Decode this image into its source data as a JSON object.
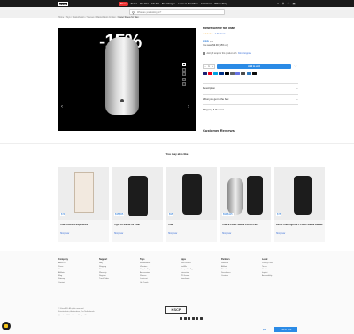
{
  "header": {
    "logo": "KSCP",
    "nav": [
      "Bleus",
      "Toutes",
      "Por Oise",
      "Fits Noi",
      "Bus Chaigne",
      "Ladies & Ammitibee",
      "Cad Orvas",
      "Where Shop"
    ],
    "icons": [
      "user-icon",
      "search-icon",
      "heart-icon",
      "cart-icon"
    ]
  },
  "search": {
    "placeholder": "What are you looking for?"
  },
  "breadcrumb": [
    "Home",
    "/",
    "Toys",
    "/",
    "Masturbators",
    "/",
    "Sleeves",
    "/",
    "Masturbators for Men",
    "/",
    "Power Sleeve for Titan"
  ],
  "gallery": {
    "badge": "-15%",
    "thumb_count": 5
  },
  "product": {
    "title": "Power Sleeve for Titan",
    "rating": "★★★★☆",
    "reviews": "1 Reviews",
    "price": "$55",
    "old_price": "$65",
    "saving": "You save $9.90 (15% off)",
    "optin": "Add gift wrap for this product with",
    "optin_link": "Kiiroo Engrave",
    "qty": "1",
    "add_to_cart": "Add to cart",
    "payments": [
      "#1a1f71",
      "#eb001b",
      "#00a1e0",
      "#003087",
      "#000000",
      "#5f6368",
      "#6772e5",
      "#4a4a4a",
      "#2e77bc",
      "#0a0a0a"
    ]
  },
  "accordions": [
    "Description",
    "What you get in the box",
    "Shipping & Returns"
  ],
  "reviews_heading": "Customer Reviews",
  "recommend_heading": "You may also like",
  "cards": [
    {
      "title": "Titan Premium Experience",
      "price": "$79",
      "cta": "Shop now"
    },
    {
      "title": "Tight Fit Sleeve for Titan",
      "price": "$35 $55",
      "cta": "Shop now"
    },
    {
      "title": "Titan",
      "price": "$95",
      "cta": "Shop now"
    },
    {
      "title": "Titan & Power Sleeve Combo Pack",
      "price": "$99 $115",
      "cta": "Shop now"
    },
    {
      "title": "Kiiroo Titan Tight Fit + Power Sleeve Bundle",
      "price": "$75",
      "cta": "Shop now"
    }
  ],
  "footer": {
    "columns": [
      {
        "head": "Company",
        "links": [
          "About Us",
          "Press",
          "Careers",
          "Affiliate",
          "Blog",
          "Sitemap",
          "Contact"
        ]
      },
      {
        "head": "Support",
        "links": [
          "FAQ",
          "Shipping",
          "Returns",
          "Warranty",
          "Register",
          "Track Order"
        ]
      },
      {
        "head": "Toys",
        "links": [
          "Masturbators",
          "Vibrators",
          "Couples Toys",
          "Accessories",
          "Sleeves",
          "Lubricant",
          "Gift Cards"
        ]
      },
      {
        "head": "Apps",
        "links": [
          "FeelConnect",
          "FeelMe",
          "Compatible Apps",
          "Interactive",
          "VR Games",
          "Downloads"
        ]
      },
      {
        "head": "Partners",
        "links": [
          "Webcam",
          "Affiliate",
          "Retailers",
          "Developers",
          "Creators"
        ]
      },
      {
        "head": "Legal",
        "links": [
          "Privacy Policy",
          "Terms",
          "Cookies",
          "Imprint",
          "Accessibility"
        ]
      }
    ],
    "copyright": "© Kiiroo BV. All rights reserved.",
    "address": "Koivistonkatu, Amsterdam, The Netherlands",
    "contact": "Questions? Contact our Support Team",
    "logo": "KSCP"
  },
  "sticky": {
    "price": "$55",
    "button": "Add to cart"
  }
}
